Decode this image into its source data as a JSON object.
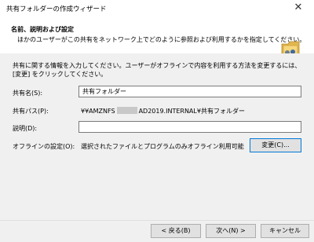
{
  "window": {
    "title": "共有フォルダーの作成ウィザード",
    "close_glyph": "✕"
  },
  "header": {
    "title": "名前、説明および設定",
    "subtitle": "ほかのユーザーがこの共有をネットワーク上でどのように参照および利用するかを指定してください。"
  },
  "form": {
    "intro": "共有に関する情報を入力してください。ユーザーがオフラインで内容を利用する方法を変更するには、[変更] をクリックしてください。",
    "share_name_label": "共有名(S):",
    "share_name_value": "共有フォルダー",
    "share_path_label": "共有パス(P):",
    "share_path_prefix": "¥¥AMZNFS",
    "share_path_suffix": "AD2019.INTERNAL¥共有フォルダー",
    "description_label": "説明(D):",
    "description_value": "",
    "offline_label": "オフラインの設定(O):",
    "offline_value": "選択されたファイルとプログラムのみオフライン利用可能",
    "change_button": "変更(C)..."
  },
  "footer": {
    "back": "< 戻る(B)",
    "next": "次へ(N) >",
    "cancel": "キャンセル"
  },
  "colors": {
    "focus_border": "#0078d7",
    "panel_bg": "#f0f0f0"
  }
}
